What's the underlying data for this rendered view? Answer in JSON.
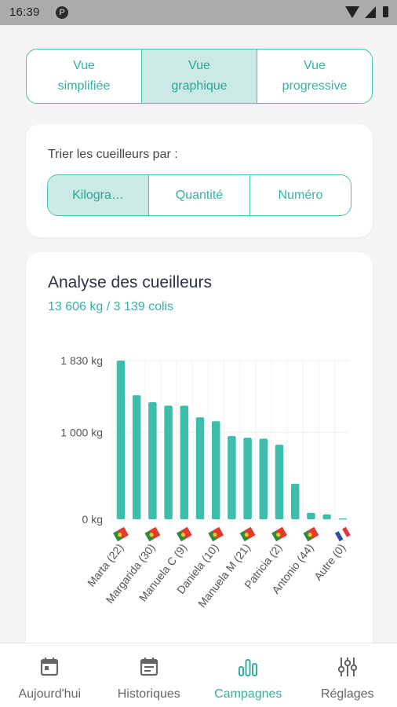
{
  "status_bar": {
    "time": "16:39"
  },
  "view_toggle": {
    "options": [
      {
        "line1": "Vue",
        "line2": "simplifiée"
      },
      {
        "line1": "Vue",
        "line2": "graphique"
      },
      {
        "line1": "Vue",
        "line2": "progressive"
      }
    ],
    "selected_index": 1
  },
  "sort": {
    "label": "Trier les cueilleurs par :",
    "options": [
      "Kilogra…",
      "Quantité",
      "Numéro"
    ],
    "selected_index": 0
  },
  "analysis": {
    "title": "Analyse des cueilleurs",
    "summary": "13 606 kg / 3 139 colis"
  },
  "chart_data": {
    "type": "bar",
    "y_ticks": [
      "1 830 kg",
      "1 000 kg",
      "0 kg"
    ],
    "ylim": [
      0,
      1830
    ],
    "grid": true,
    "color": "#3dbdac",
    "values": [
      1830,
      1430,
      1350,
      1310,
      1310,
      1175,
      1130,
      960,
      940,
      930,
      860,
      410,
      75,
      55,
      10
    ],
    "labeled_categories": [
      {
        "bar_index": 0,
        "label": "Marta (22)",
        "flag": "portugal"
      },
      {
        "bar_index": 2,
        "label": "Margarida (30)",
        "flag": "portugal"
      },
      {
        "bar_index": 4,
        "label": "Manuela C (9)",
        "flag": "portugal"
      },
      {
        "bar_index": 6,
        "label": "Daniela (10)",
        "flag": "portugal"
      },
      {
        "bar_index": 8,
        "label": "Manuela M (21)",
        "flag": "portugal"
      },
      {
        "bar_index": 10,
        "label": "Patricia (2)",
        "flag": "portugal"
      },
      {
        "bar_index": 12,
        "label": "Antonio (44)",
        "flag": "portugal"
      },
      {
        "bar_index": 14,
        "label": "Autre (0)",
        "flag": "france"
      }
    ]
  },
  "bottom_nav": {
    "items": [
      {
        "label": "Aujourd'hui",
        "icon": "calendar-icon"
      },
      {
        "label": "Historiques",
        "icon": "history-calendar-icon"
      },
      {
        "label": "Campagnes",
        "icon": "bar-chart-icon"
      },
      {
        "label": "Réglages",
        "icon": "sliders-icon"
      }
    ],
    "selected_index": 2
  }
}
